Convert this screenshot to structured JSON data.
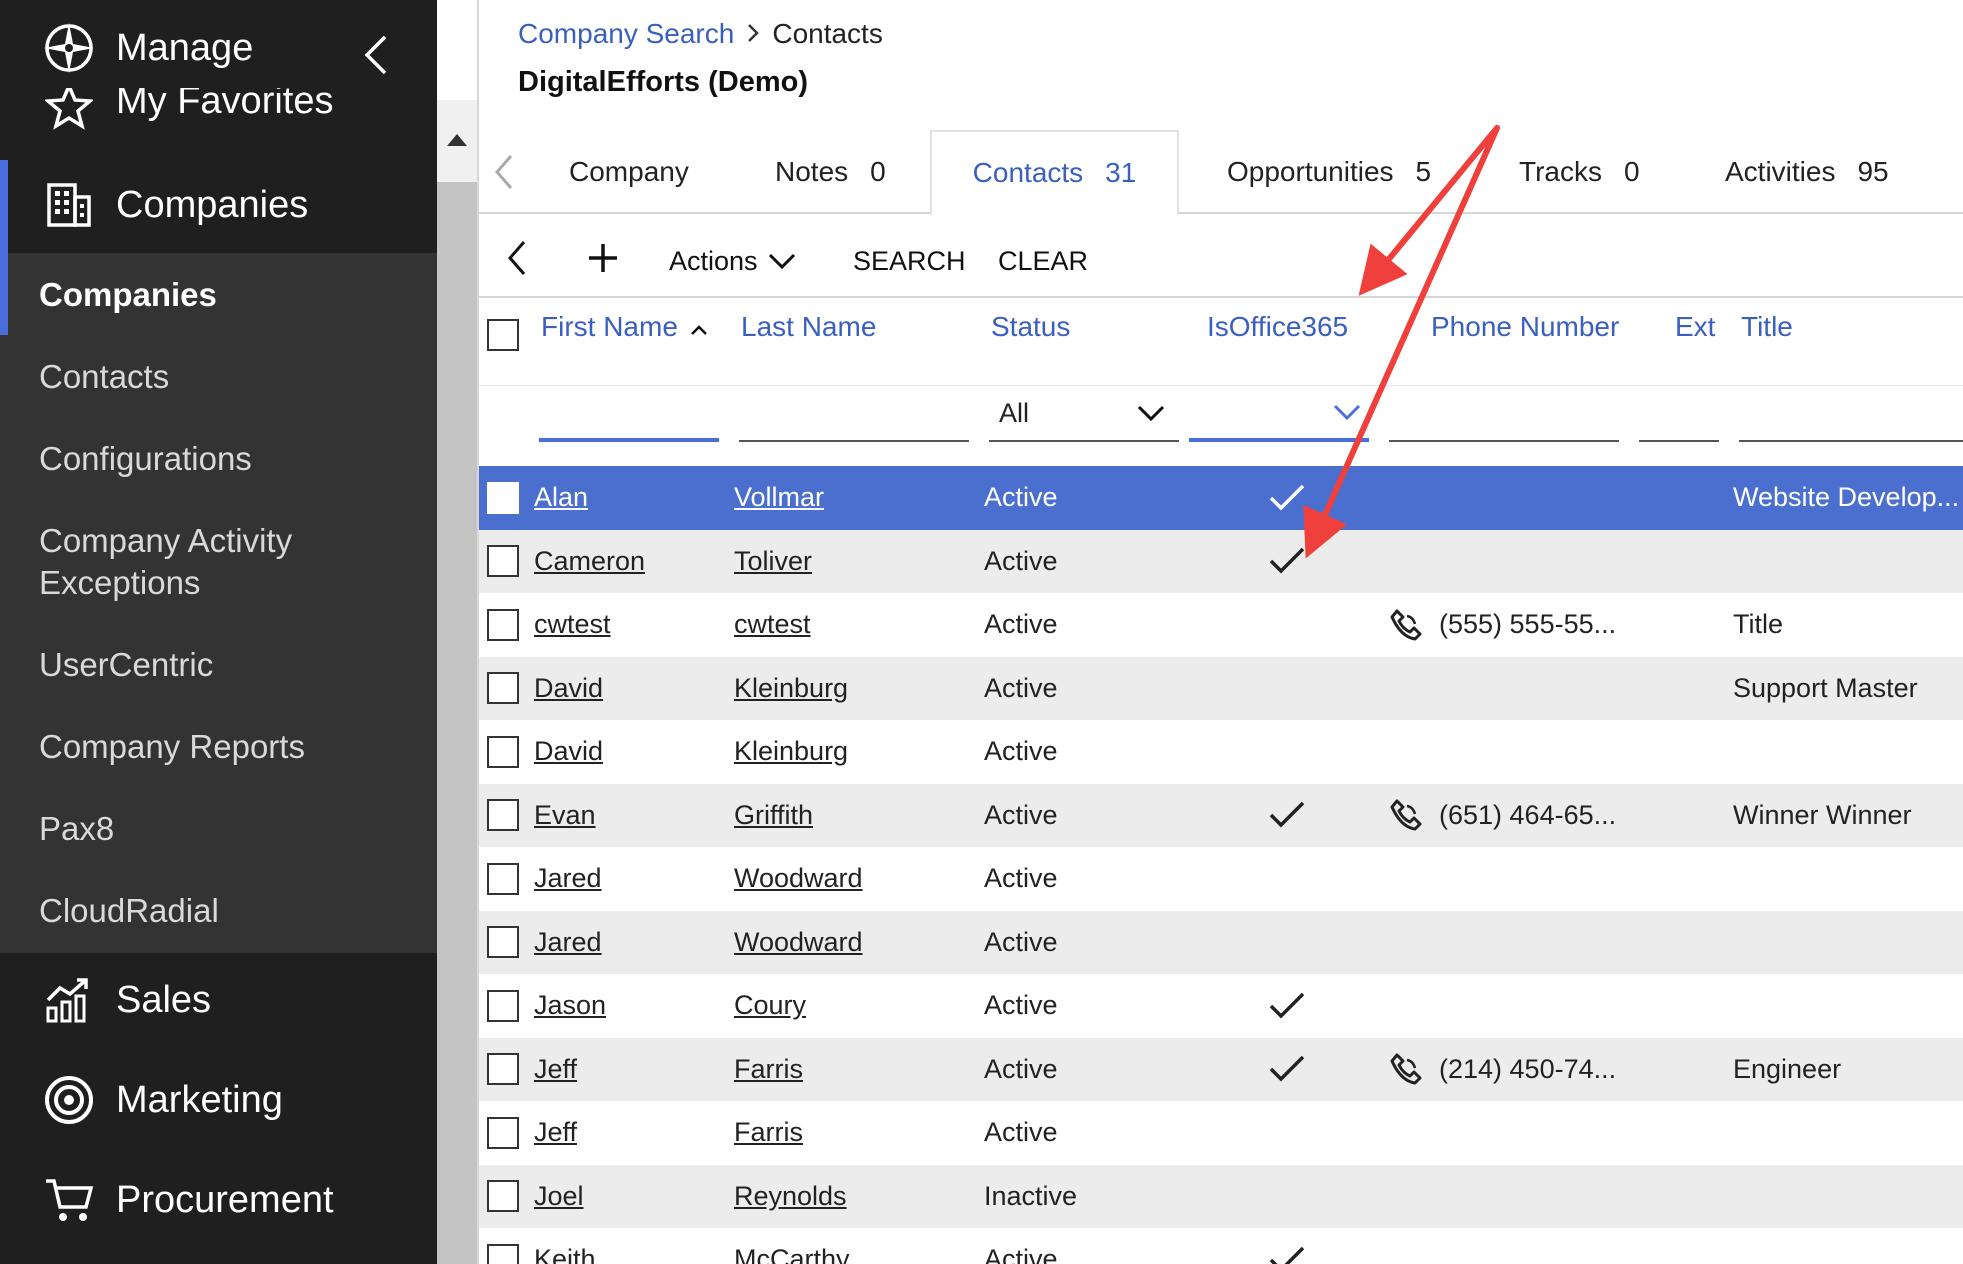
{
  "sidebar": {
    "manage_label": "Manage",
    "favorites_label": "My Favorites",
    "companies_label": "Companies",
    "submenu": [
      {
        "label": "Companies",
        "active": true
      },
      {
        "label": "Contacts",
        "active": false
      },
      {
        "label": "Configurations",
        "active": false
      },
      {
        "label": "Company Activity Exceptions",
        "active": false
      },
      {
        "label": "UserCentric",
        "active": false
      },
      {
        "label": "Company Reports",
        "active": false
      },
      {
        "label": "Pax8",
        "active": false
      },
      {
        "label": "CloudRadial",
        "active": false
      }
    ],
    "sales_label": "Sales",
    "marketing_label": "Marketing",
    "procurement_label": "Procurement"
  },
  "breadcrumb": {
    "parent": "Company Search",
    "current": "Contacts"
  },
  "company_title": "DigitalEfforts (Demo)",
  "tabs": [
    {
      "label": "Company",
      "count": ""
    },
    {
      "label": "Notes",
      "count": "0"
    },
    {
      "label": "Contacts",
      "count": "31"
    },
    {
      "label": "Opportunities",
      "count": "5"
    },
    {
      "label": "Tracks",
      "count": "0"
    },
    {
      "label": "Activities",
      "count": "95"
    }
  ],
  "toolbar": {
    "actions_label": "Actions",
    "search_label": "SEARCH",
    "clear_label": "CLEAR"
  },
  "grid": {
    "columns": {
      "first_name": "First Name",
      "last_name": "Last Name",
      "status": "Status",
      "is_office365": "IsOffice365",
      "phone": "Phone Number",
      "ext": "Ext",
      "title": "Title"
    },
    "status_filter_value": "All",
    "rows": [
      {
        "first": "Alan",
        "last": "Vollmar",
        "status": "Active",
        "o365": true,
        "phone": "",
        "title": "Website Develop..."
      },
      {
        "first": "Cameron",
        "last": "Toliver",
        "status": "Active",
        "o365": true,
        "phone": "",
        "title": ""
      },
      {
        "first": "cwtest",
        "last": "cwtest",
        "status": "Active",
        "o365": false,
        "phone": "(555) 555-55...",
        "title": "Title"
      },
      {
        "first": "David",
        "last": "Kleinburg",
        "status": "Active",
        "o365": false,
        "phone": "",
        "title": "Support Master"
      },
      {
        "first": "David",
        "last": "Kleinburg",
        "status": "Active",
        "o365": false,
        "phone": "",
        "title": ""
      },
      {
        "first": "Evan",
        "last": "Griffith",
        "status": "Active",
        "o365": true,
        "phone": "(651) 464-65...",
        "title": "Winner Winner"
      },
      {
        "first": "Jared",
        "last": "Woodward",
        "status": "Active",
        "o365": false,
        "phone": "",
        "title": ""
      },
      {
        "first": "Jared",
        "last": "Woodward",
        "status": "Active",
        "o365": false,
        "phone": "",
        "title": ""
      },
      {
        "first": "Jason",
        "last": "Coury",
        "status": "Active",
        "o365": true,
        "phone": "",
        "title": ""
      },
      {
        "first": "Jeff",
        "last": "Farris",
        "status": "Active",
        "o365": true,
        "phone": "(214) 450-74...",
        "title": "Engineer"
      },
      {
        "first": "Jeff",
        "last": "Farris",
        "status": "Active",
        "o365": false,
        "phone": "",
        "title": ""
      },
      {
        "first": "Joel",
        "last": "Reynolds",
        "status": "Inactive",
        "o365": false,
        "phone": "",
        "title": ""
      },
      {
        "first": "Keith",
        "last": "McCarthy",
        "status": "Active",
        "o365": true,
        "phone": "",
        "title": ""
      }
    ]
  },
  "colors": {
    "accent": "#4a6fdc",
    "selected_row": "#4a6fcf",
    "link_blue": "#3b5fc0",
    "sidebar_dark": "#1f1f1f",
    "sidebar_sub": "#333333",
    "annotation_arrow": "#f0403c"
  },
  "icons": {
    "manage": "compass-icon",
    "favorites": "star-icon",
    "companies": "building-icon",
    "sales": "chart-icon",
    "marketing": "target-icon",
    "procurement": "cart-icon",
    "phone": "phone-icon",
    "check": "check-icon"
  }
}
